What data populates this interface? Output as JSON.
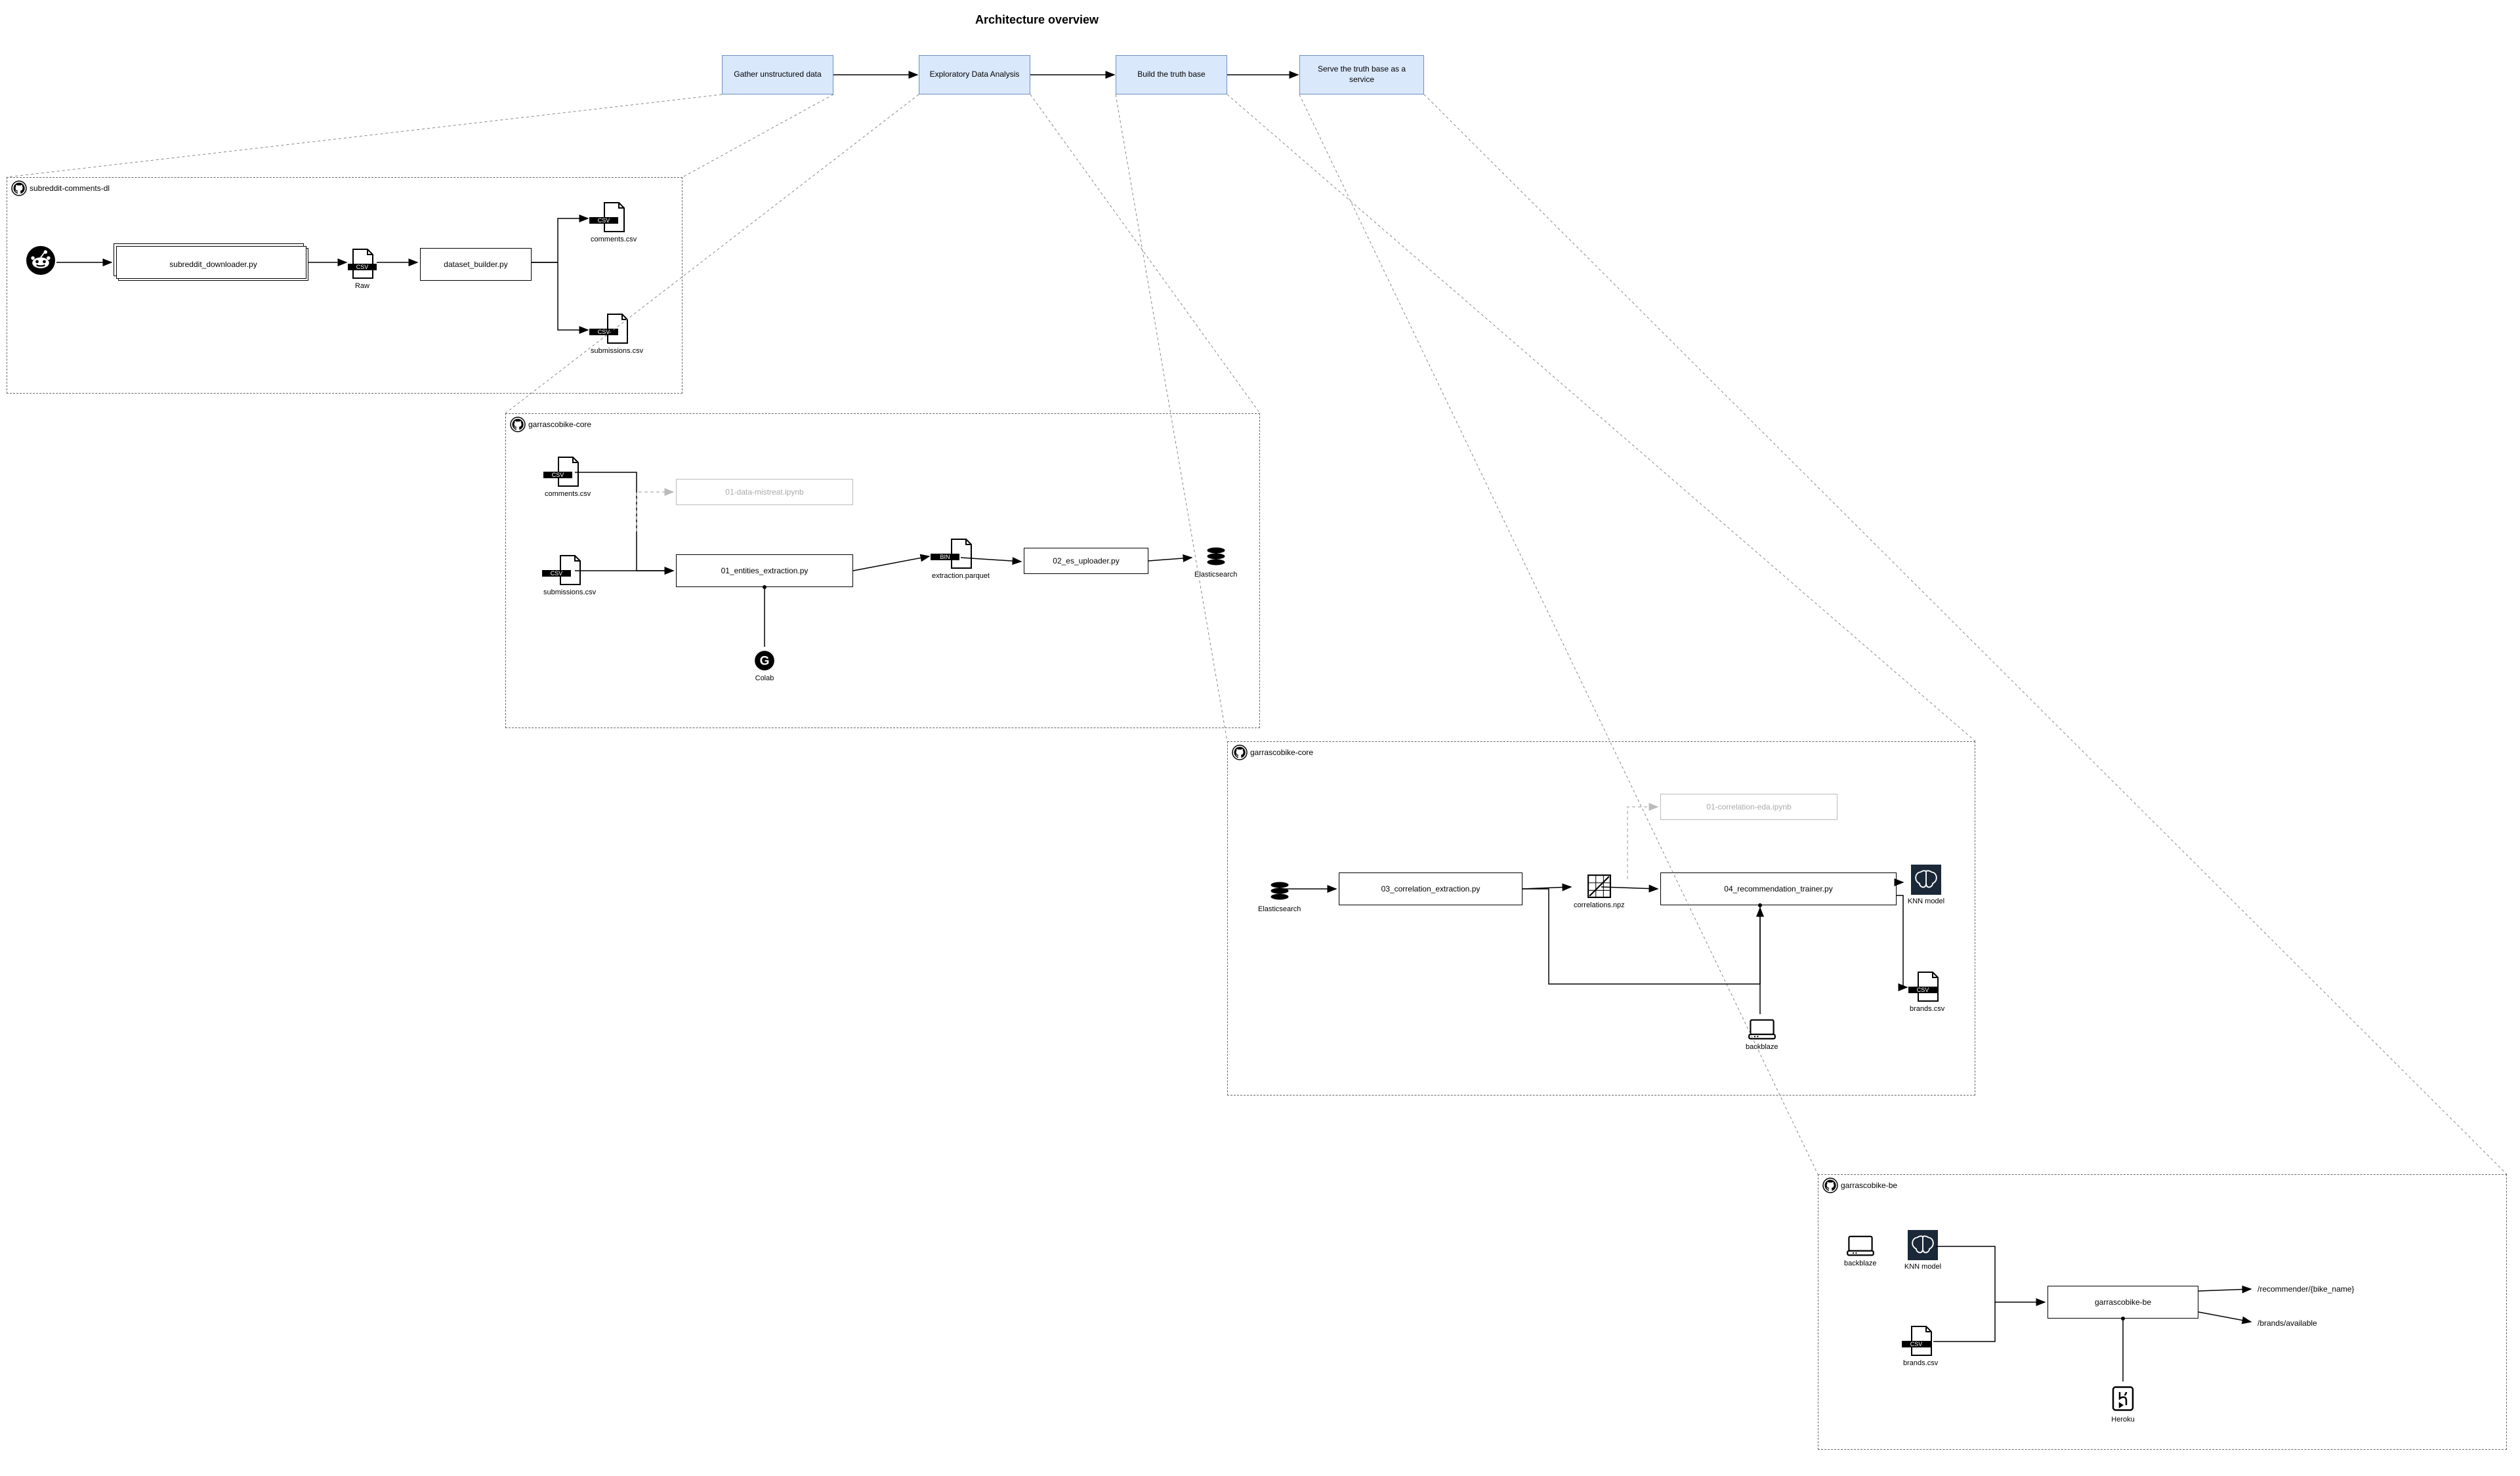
{
  "title": "Architecture overview",
  "stages": {
    "s1": "Gather unstructured data",
    "s2": "Exploratory Data Analysis",
    "s3": "Build the truth base",
    "s4": "Serve the truth base as a service"
  },
  "repo1": {
    "name": "subreddit-comments-dl",
    "n1": "subreddit_downloader.py",
    "raw": "Raw",
    "n2": "dataset_builder.py",
    "out1": "comments.csv",
    "out2": "submissions.csv"
  },
  "repo2": {
    "name": "garrascobike-core",
    "in1": "comments.csv",
    "in2": "submissions.csv",
    "light": "01-data-mistreat.ipynb",
    "n1": "01_entities_extraction.py",
    "colab": "Colab",
    "mid": "extraction.parquet",
    "n2": "02_es_uploader.py",
    "out": "Elasticsearch"
  },
  "repo3": {
    "name": "garrascobike-core",
    "in": "Elasticsearch",
    "n1": "03_correlation_extraction.py",
    "mid": "correlations.npz",
    "light": "01-correlation-eda.ipynb",
    "n2": "04_recommendation_trainer.py",
    "bb": "backblaze",
    "out1": "KNN model",
    "out2": "brands.csv"
  },
  "repo4": {
    "name": "garrascobike-be",
    "in1": "backblaze",
    "in2": "KNN model",
    "in3": "brands.csv",
    "n1": "garrascobike-be",
    "heroku": "Heroku",
    "api1": "/recommender/{bike_name}",
    "api2": "/brands/available"
  }
}
